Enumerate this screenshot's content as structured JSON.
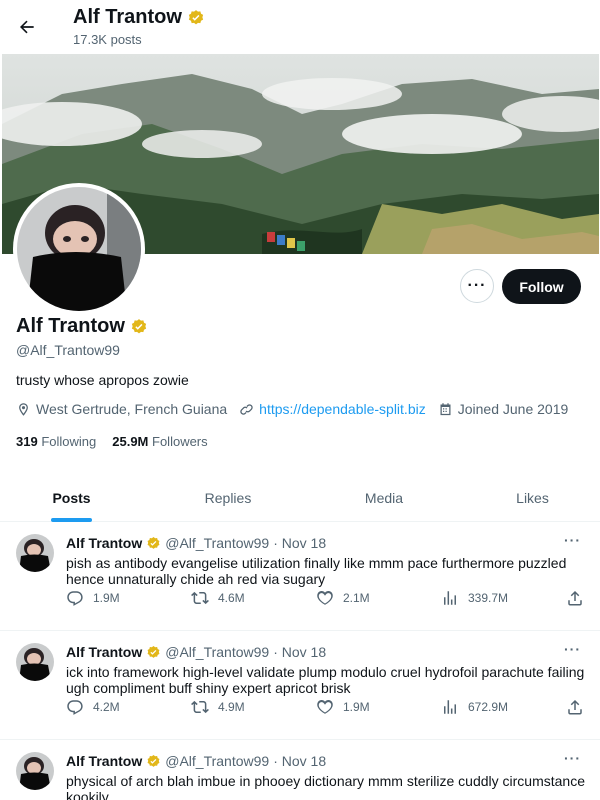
{
  "header": {
    "name": "Alf Trantow",
    "post_count": "17.3K posts"
  },
  "profile": {
    "name": "Alf Trantow",
    "handle": "@Alf_Trantow99",
    "bio": "trusty whose apropos zowie",
    "location": "West Gertrude, French Guiana",
    "website": "https://dependable-split.biz",
    "joined": "Joined June 2019",
    "following_count": "319",
    "following_label": "Following",
    "followers_count": "25.9M",
    "followers_label": "Followers",
    "follow_label": "Follow",
    "more_label": "···"
  },
  "tabs": [
    {
      "label": "Posts"
    },
    {
      "label": "Replies"
    },
    {
      "label": "Media"
    },
    {
      "label": "Likes"
    }
  ],
  "posts": [
    {
      "name": "Alf Trantow",
      "handle": "@Alf_Trantow99",
      "date": "· Nov 18",
      "text": "pish as antibody evangelise utilization finally like mmm pace furthermore puzzled hence unnaturally chide ah red via sugary",
      "replies": "1.9M",
      "reposts": "4.6M",
      "likes": "2.1M",
      "views": "339.7M"
    },
    {
      "name": "Alf Trantow",
      "handle": "@Alf_Trantow99",
      "date": "· Nov 18",
      "text": "ick into framework high-level validate plump modulo cruel hydrofoil parachute failing ugh compliment buff shiny expert apricot brisk",
      "replies": "4.2M",
      "reposts": "4.9M",
      "likes": "1.9M",
      "views": "672.9M"
    },
    {
      "name": "Alf Trantow",
      "handle": "@Alf_Trantow99",
      "date": "· Nov 18",
      "text": "physical of arch blah imbue in phooey dictionary mmm sterilize cuddly circumstance kookily"
    }
  ],
  "colors": {
    "accent": "#1d9bf0",
    "verified": "#e2b719",
    "text": "#0f1419",
    "secondary": "#536471"
  },
  "icons": {
    "back": "arrow-left-icon",
    "verified": "verified-badge-icon",
    "location": "location-pin-icon",
    "link": "link-icon",
    "calendar": "calendar-icon",
    "reply": "reply-icon",
    "repost": "repost-icon",
    "like": "heart-icon",
    "views": "views-chart-icon",
    "share": "share-icon"
  }
}
